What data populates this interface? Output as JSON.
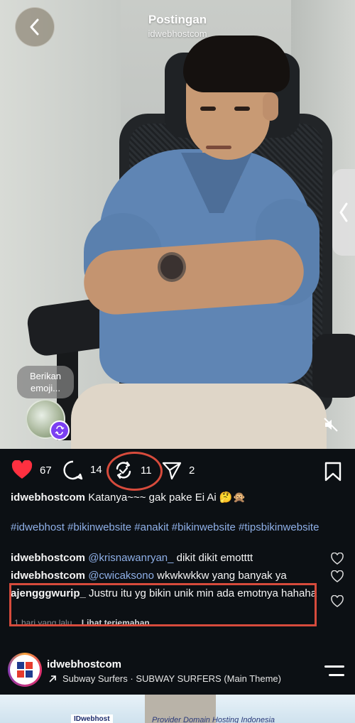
{
  "header": {
    "title": "Postingan",
    "subtitle": "idwebhostcom"
  },
  "video": {
    "emoji_prompt": "Berikan emoji..."
  },
  "actions": {
    "likes": "67",
    "comments": "14",
    "reposts": "11",
    "shares": "2"
  },
  "caption": {
    "username": "idwebhostcom",
    "text": "Katanya~~~ gak pake Ei Ai 🤔🙊",
    "hashtags": "#idwebhost #bikinwebsite #anakit #bikinwebsite #tipsbikinwebsite"
  },
  "comments": [
    {
      "username": "idwebhostcom",
      "mention": "@krisnawanryan_",
      "text": " dikit dikit emotttt"
    },
    {
      "username": "idwebhostcom",
      "mention": "@cwicaksono",
      "text": " wkwkwkkw yang banyak ya"
    },
    {
      "username": "ajengggwurip_",
      "mention": "",
      "text": " Justru itu yg bikin unik min ada emotnya hahaha"
    }
  ],
  "comment_meta": {
    "time": "1 hari yang lalu",
    "translate": "Lihat terjemahan"
  },
  "profile": {
    "name": "idwebhostcom",
    "music": "Subway Surfers · SUBWAY SURFERS  (Main Theme)"
  },
  "next_post": {
    "logo_text": "IDwebhost",
    "tagline": "Provider Domain Hosting Indonesia"
  },
  "colors": {
    "like_red": "#ff3040",
    "link_blue": "#8fb0e8",
    "annotation_red": "#d74b3c",
    "repost_badge": "#7b3ff2"
  }
}
